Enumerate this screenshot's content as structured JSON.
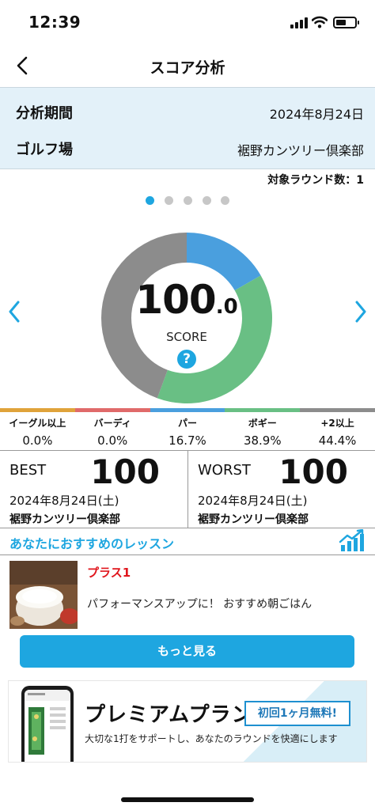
{
  "status_bar": {
    "time": "12:39"
  },
  "nav": {
    "title": "スコア分析"
  },
  "info": {
    "period_label": "分析期間",
    "period_value": "2024年8月24日",
    "course_label": "ゴルフ場",
    "course_value": "裾野カンツリー倶楽部"
  },
  "round_count": "対象ラウンド数：1",
  "score": {
    "main": "100",
    "decimal": ".0",
    "label": "SCORE",
    "help": "?"
  },
  "donut_segments": [
    {
      "name": "パー",
      "value": 16.7,
      "color": "#4a9fde"
    },
    {
      "name": "ボギー",
      "value": 38.9,
      "color": "#69bf84"
    },
    {
      "name": "+2以上",
      "value": 44.4,
      "color": "#8c8c8c"
    }
  ],
  "strip_colors": [
    "#e0a33a",
    "#e06a6a",
    "#4a9fde",
    "#69bf84",
    "#8c8c8c"
  ],
  "distribution": [
    {
      "label": "イーグル以上",
      "value": "0.0%"
    },
    {
      "label": "バーディ",
      "value": "0.0%"
    },
    {
      "label": "パー",
      "value": "16.7%"
    },
    {
      "label": "ボギー",
      "value": "38.9%"
    },
    {
      "label": "+2以上",
      "value": "44.4%"
    }
  ],
  "best": {
    "label": "BEST",
    "score": "100",
    "date": "2024年8月24日(土)",
    "course": "裾野カンツリー倶楽部"
  },
  "worst": {
    "label": "WORST",
    "score": "100",
    "date": "2024年8月24日(土)",
    "course": "裾野カンツリー倶楽部"
  },
  "lessons": {
    "title": "あなたにおすすめのレッスン",
    "card": {
      "tag": "プラス1",
      "text": "パフォーマンスアップに！ おすすめ朝ごはん"
    },
    "more_label": "もっと見る"
  },
  "premium": {
    "title": "プレミアムプラン",
    "badge": "初回1ヶ月無料!",
    "subtitle": "大切な1打をサポートし、あなたのラウンドを快適にします"
  },
  "colors": {
    "accent": "#1ea6e0",
    "tag_red": "#e0161d",
    "info_bg": "#e3f1f9"
  }
}
